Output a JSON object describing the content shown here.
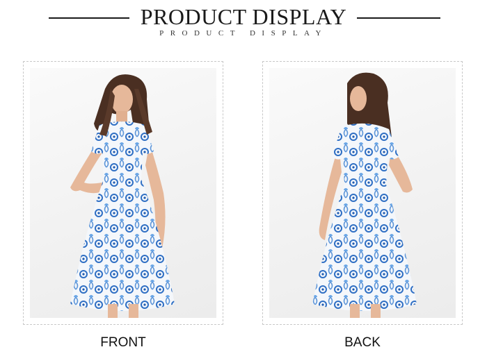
{
  "header": {
    "title": "PRODUCT DISPLAY",
    "subtitle": "PRODUCT DISPLAY"
  },
  "views": [
    {
      "label": "FRONT",
      "image": "dress-front-photo"
    },
    {
      "label": "BACK",
      "image": "dress-back-photo"
    }
  ],
  "colors": {
    "pattern_blue": "#2f6fc4",
    "dress_base": "#f4f7fb",
    "hair": "#4a2f22",
    "skin": "#e6b89a"
  }
}
